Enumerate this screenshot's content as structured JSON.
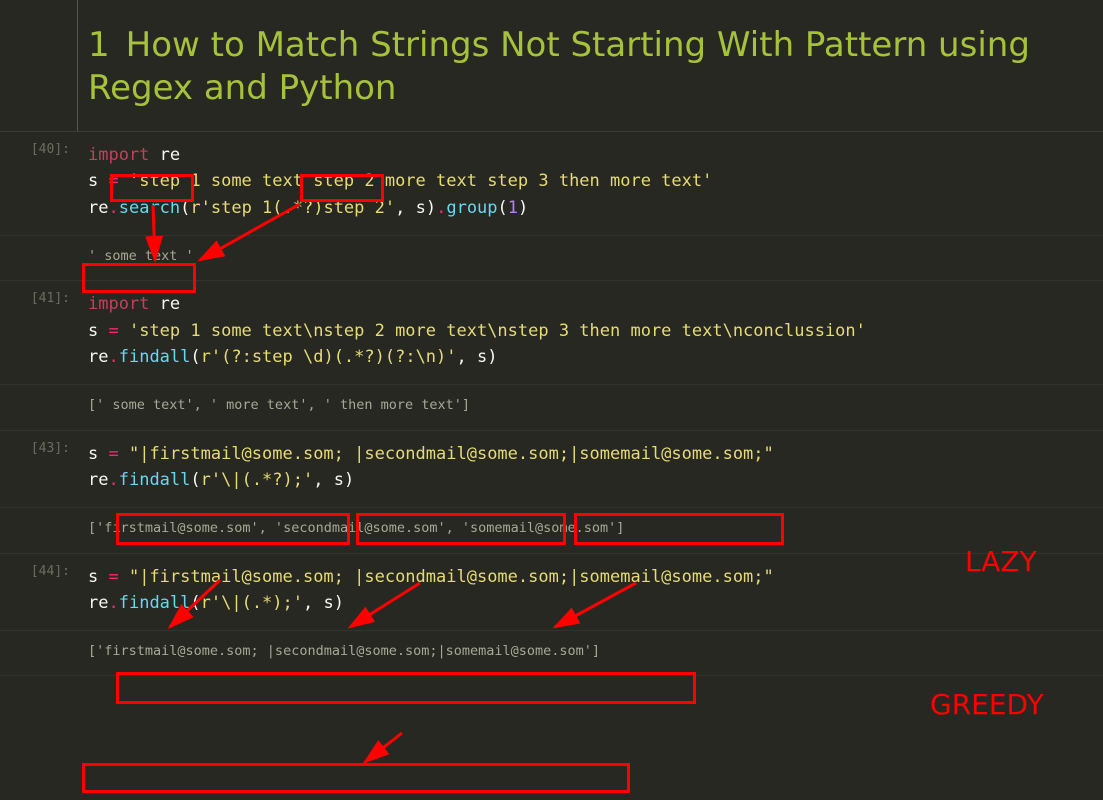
{
  "heading": {
    "number": "1",
    "title": "How to Match Strings Not Starting With Pattern using Regex and Python"
  },
  "cells": [
    {
      "prompt": "[40]:",
      "code": {
        "l1_import": "import",
        "l1_re": " re",
        "l2_s": "s ",
        "l2_eq": "= ",
        "l2_str": "'step 1 some text step 2 more text step 3 then more text'",
        "l3_re": "re",
        "l3_dot1": ".",
        "l3_search": "search",
        "l3_open": "(",
        "l3_arg1": "r'step 1(.*?)step 2'",
        "l3_comma": ", ",
        "l3_arg2": "s",
        "l3_close": ")",
        "l3_dot2": ".",
        "l3_group": "group",
        "l3_open2": "(",
        "l3_num": "1",
        "l3_close2": ")"
      },
      "output": "' some text '"
    },
    {
      "prompt": "[41]:",
      "code": {
        "l1_import": "import",
        "l1_re": " re",
        "l2_s": "s ",
        "l2_eq": "= ",
        "l2_str": "'step 1 some text\\nstep 2 more text\\nstep 3 then more text\\nconclussion'",
        "l3_re": "re",
        "l3_dot1": ".",
        "l3_findall": "findall",
        "l3_open": "(",
        "l3_arg1": "r'(?:step \\d)(.*?)(?:\\n)'",
        "l3_comma": ", ",
        "l3_arg2": "s",
        "l3_close": ")"
      },
      "output": "[' some text', ' more text', ' then more text']"
    },
    {
      "prompt": "[43]:",
      "code": {
        "l1_s": "s ",
        "l1_eq": "= ",
        "l1_str": "\"|firstmail@some.som; |secondmail@some.som;|somemail@some.som;\"",
        "l2_re": "re",
        "l2_dot1": ".",
        "l2_findall": "findall",
        "l2_open": "(",
        "l2_arg1": "r'\\|(.*?);'",
        "l2_comma": ", ",
        "l2_arg2": "s",
        "l2_close": ")"
      },
      "output": "['firstmail@some.som', 'secondmail@some.som', 'somemail@some.som']"
    },
    {
      "prompt": "[44]:",
      "code": {
        "l1_s": "s ",
        "l1_eq": "= ",
        "l1_str": "\"|firstmail@some.som; |secondmail@some.som;|somemail@some.som;\"",
        "l2_re": "re",
        "l2_dot1": ".",
        "l2_findall": "findall",
        "l2_open": "(",
        "l2_arg1": "r'\\|(.*);'",
        "l2_comma": ", ",
        "l2_arg2": "s",
        "l2_close": ")"
      },
      "output": "['firstmail@some.som; |secondmail@some.som;|somemail@some.som']"
    }
  ],
  "annotations": {
    "label_lazy": "LAZY",
    "label_greedy": "GREEDY"
  }
}
